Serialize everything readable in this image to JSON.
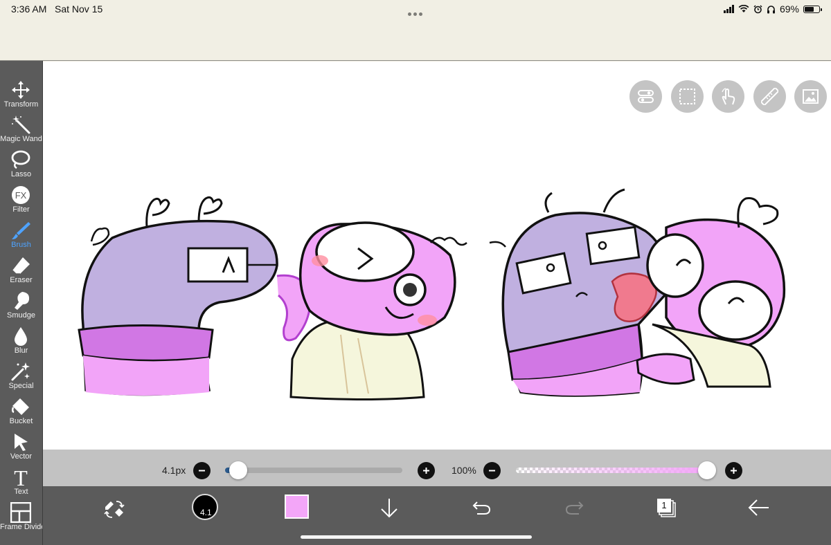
{
  "status_bar": {
    "time": "3:36 AM",
    "date": "Sat Nov 15",
    "battery_percent": "69%",
    "battery_level": 0.69,
    "icons": [
      "signal-icon",
      "wifi-icon",
      "alarm-icon",
      "headphones-icon",
      "battery-icon"
    ]
  },
  "toolbar": {
    "tools": [
      {
        "label": "Transform",
        "icon": "transform-icon"
      },
      {
        "label": "Magic Wand",
        "icon": "magic-wand-icon"
      },
      {
        "label": "Lasso",
        "icon": "lasso-icon"
      },
      {
        "label": "Filter",
        "icon": "filter-fx-icon",
        "glyph": "FX"
      },
      {
        "label": "Brush",
        "icon": "brush-icon",
        "active": true
      },
      {
        "label": "Eraser",
        "icon": "eraser-icon"
      },
      {
        "label": "Smudge",
        "icon": "smudge-icon"
      },
      {
        "label": "Blur",
        "icon": "blur-drop-icon"
      },
      {
        "label": "Special",
        "icon": "special-sparkle-icon"
      },
      {
        "label": "Bucket",
        "icon": "bucket-icon"
      },
      {
        "label": "Vector",
        "icon": "vector-arrow-icon"
      },
      {
        "label": "Text",
        "icon": "text-icon",
        "glyph": "T"
      },
      {
        "label": "Frame Divider",
        "icon": "frame-divider-icon"
      }
    ]
  },
  "canvas": {
    "quick_actions": [
      "toggle-panel-icon",
      "selection-icon",
      "touch-gesture-icon",
      "ruler-icon",
      "image-icon"
    ],
    "artwork": "drawing of purple and pink cartoon characters"
  },
  "sliders": {
    "brush_size_label": "4.1px",
    "brush_size_level": 0.03,
    "opacity_label": "100%",
    "opacity_level": 1.0,
    "colors": {
      "size_fill": "#2b5a8c",
      "opacity_color": "#f3a6f8"
    }
  },
  "bottom_bar": {
    "brush_preview_label": "4.1",
    "current_color": "#f3a6f8",
    "layer_count": "1",
    "items": [
      "swap-tools-icon",
      "brush-preview",
      "color-swatch",
      "download-arrow-icon",
      "undo-icon",
      "redo-icon",
      "layers-icon",
      "back-arrow-icon"
    ]
  }
}
